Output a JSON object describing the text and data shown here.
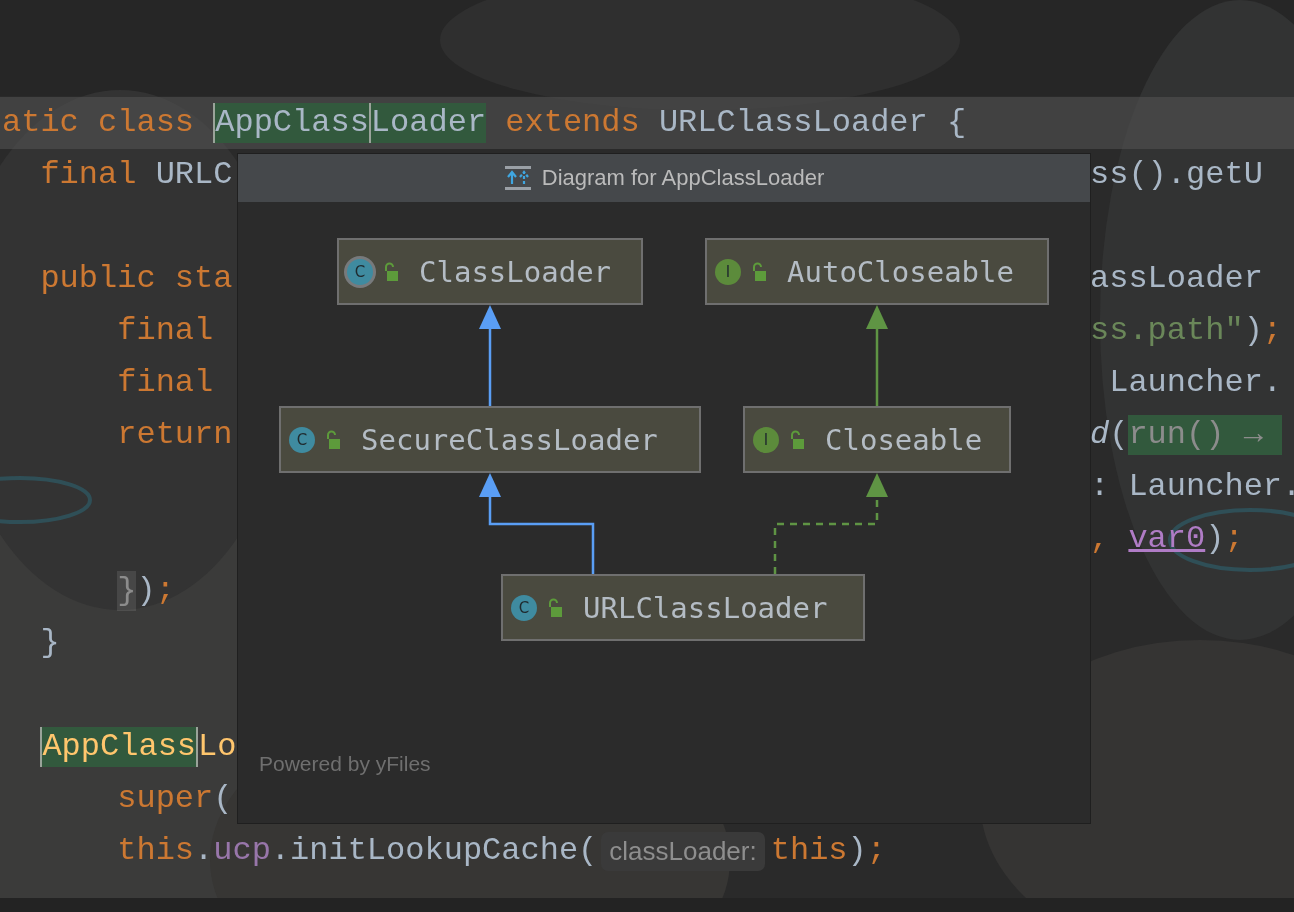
{
  "editor": {
    "lines": [
      {
        "current": true,
        "left": [
          {
            "t": "atic class ",
            "kind": "keyword"
          },
          {
            "t": "AppClass",
            "kind": "plain",
            "found": true,
            "marked": true
          },
          {
            "t": "Loader",
            "kind": "plain",
            "marked": true
          },
          {
            "t": " extends ",
            "kind": "keyword"
          },
          {
            "t": "URLClassLoader {",
            "kind": "plain"
          }
        ]
      },
      {
        "current": false,
        "left": [
          {
            "t": "  final ",
            "kind": "keyword"
          },
          {
            "t": "URLC",
            "kind": "plain"
          }
        ],
        "right": [
          {
            "t": "ss().getU",
            "kind": "plain"
          }
        ]
      },
      {
        "current": false
      },
      {
        "current": false,
        "left": [
          {
            "t": "  public sta",
            "kind": "keyword"
          }
        ],
        "right": [
          {
            "t": "assLoader",
            "kind": "plain"
          }
        ]
      },
      {
        "left": [
          {
            "t": "      final",
            "kind": "keyword"
          }
        ],
        "right": [
          {
            "t": "ss.path\"",
            "kind": "string"
          },
          {
            "t": ")",
            "kind": "plain"
          },
          {
            "t": ";",
            "kind": "keyword"
          }
        ]
      },
      {
        "left": [
          {
            "t": "      final",
            "kind": "keyword"
          }
        ],
        "right": [
          {
            "t": " Launcher.",
            "kind": "plain"
          }
        ]
      },
      {
        "left": [
          {
            "t": "      return",
            "kind": "keyword"
          }
        ],
        "right": [
          {
            "t": "d",
            "kind": "italic"
          },
          {
            "t": "(",
            "kind": "plain"
          },
          {
            "t": "run() → ",
            "kind": "lambda",
            "marked": true
          }
        ]
      },
      {
        "right": [
          {
            "t": ": Launcher.",
            "kind": "plain"
          }
        ]
      },
      {
        "right": [
          {
            "t": ", ",
            "kind": "keyword"
          },
          {
            "t": "var0",
            "kind": "var"
          },
          {
            "t": ")",
            "kind": "plain"
          },
          {
            "t": ";",
            "kind": "keyword"
          }
        ]
      },
      {
        "left": [
          {
            "t": "      }",
            "kind": "brace",
            "paired": true
          },
          {
            "t": ")",
            "kind": "plain"
          },
          {
            "t": ";",
            "kind": "keyword"
          }
        ]
      },
      {
        "current": false,
        "left": [
          {
            "t": "  }",
            "kind": "plain"
          }
        ]
      },
      {
        "current": false
      },
      {
        "current": false,
        "left": [
          {
            "t": "  AppClass",
            "kind": "method",
            "found": true,
            "marked": true
          },
          {
            "t": "Lo",
            "kind": "method"
          }
        ]
      },
      {
        "left": [
          {
            "t": "      super",
            "kind": "keyword"
          },
          {
            "t": "(",
            "kind": "plain"
          }
        ]
      },
      {
        "left": [
          {
            "t": "      this",
            "kind": "keyword"
          },
          {
            "t": ".",
            "kind": "plain"
          },
          {
            "t": "ucp",
            "kind": "field"
          },
          {
            "t": ".initLookupCache(",
            "kind": "plain"
          },
          {
            "t": "classLoader:",
            "kind": "hint"
          },
          {
            "t": "this",
            "kind": "keyword"
          },
          {
            "t": ")",
            "kind": "plain"
          },
          {
            "t": ";",
            "kind": "keyword"
          }
        ]
      }
    ]
  },
  "popup": {
    "title": "Diagram for AppClassLoader",
    "nodes": [
      {
        "name": "ClassLoader",
        "kind": "abstract-class",
        "badge": "C"
      },
      {
        "name": "AutoCloseable",
        "kind": "interface",
        "badge": "I"
      },
      {
        "name": "SecureClassLoader",
        "kind": "class",
        "badge": "C"
      },
      {
        "name": "Closeable",
        "kind": "interface",
        "badge": "I"
      },
      {
        "name": "URLClassLoader",
        "kind": "class",
        "badge": "C"
      }
    ],
    "edges": [
      {
        "kind": "class-extends"
      },
      {
        "kind": "interface-extends"
      },
      {
        "kind": "class-extends"
      },
      {
        "kind": "implements"
      }
    ],
    "footer": "Powered by yFiles"
  }
}
